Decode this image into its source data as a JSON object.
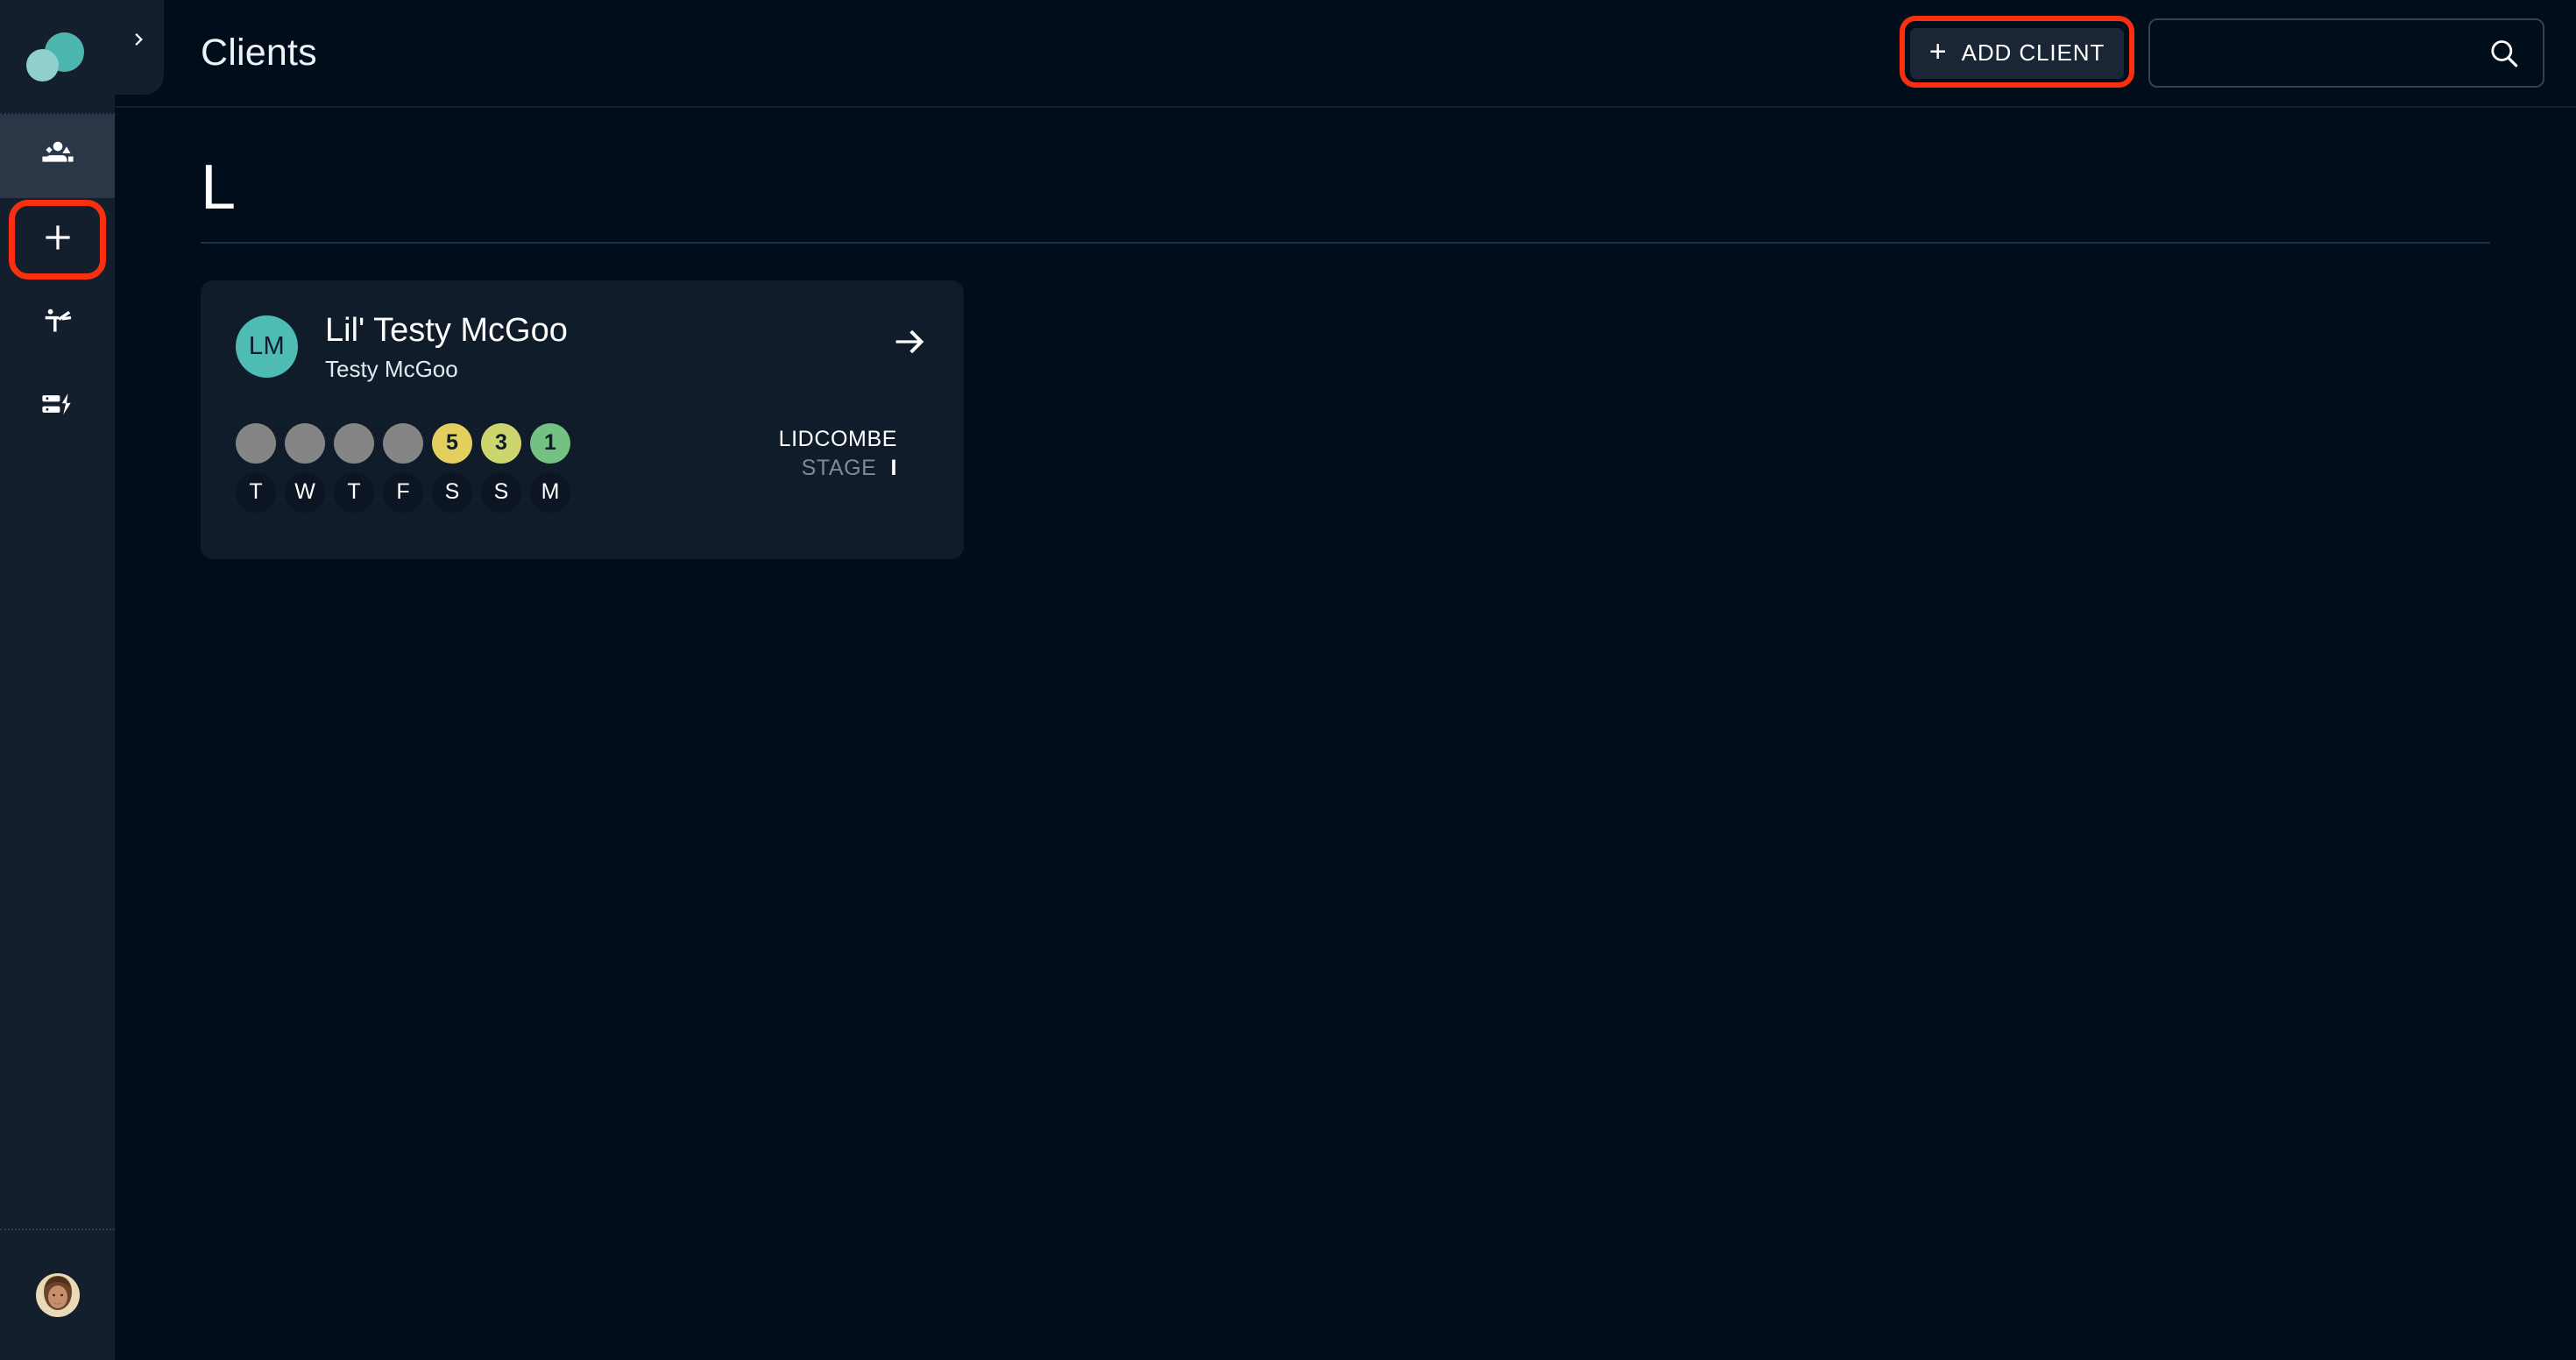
{
  "app": {
    "brand_logo_icon": "two-circles-logo",
    "accent_teal": "#4cb5ad",
    "background": "#020d1c",
    "sidebar_background": "#141f2e",
    "annotation_color": "#fa2f10"
  },
  "sidebar": {
    "collapse_toggle_icon": "chevron-right-icon",
    "items": [
      {
        "icon": "people-group-icon",
        "active": true,
        "highlighted": false
      },
      {
        "icon": "plus-icon",
        "active": false,
        "highlighted": true
      },
      {
        "icon": "exercise-person-icon",
        "active": false,
        "highlighted": false
      },
      {
        "icon": "data-lightning-icon",
        "active": false,
        "highlighted": false
      }
    ],
    "profile_avatar_icon": "user-photo-avatar"
  },
  "header": {
    "title": "Clients",
    "add_client": {
      "label": "ADD CLIENT",
      "icon": "plus-icon",
      "highlighted": true
    },
    "search": {
      "value": "",
      "placeholder": "",
      "icon": "search-icon"
    }
  },
  "main": {
    "groups": [
      {
        "letter": "L",
        "clients": [
          {
            "initials": "LM",
            "display_name": "Lil' Testy McGoo",
            "full_name": "Testy McGoo",
            "open_icon": "arrow-right-icon",
            "week": {
              "days": [
                "T",
                "W",
                "T",
                "F",
                "S",
                "S",
                "M"
              ],
              "scores": [
                {
                  "value": "",
                  "state": "empty",
                  "color": "#858585"
                },
                {
                  "value": "",
                  "state": "empty",
                  "color": "#858585"
                },
                {
                  "value": "",
                  "state": "empty",
                  "color": "#858585"
                },
                {
                  "value": "",
                  "state": "empty",
                  "color": "#858585"
                },
                {
                  "value": "5",
                  "state": "amber",
                  "color": "#e3cf5d"
                },
                {
                  "value": "3",
                  "state": "lime",
                  "color": "#cdd66e"
                },
                {
                  "value": "1",
                  "state": "green",
                  "color": "#74c182"
                }
              ]
            },
            "program": {
              "name": "LIDCOMBE",
              "stage_label": "STAGE",
              "stage_value": "I"
            }
          }
        ]
      }
    ]
  }
}
